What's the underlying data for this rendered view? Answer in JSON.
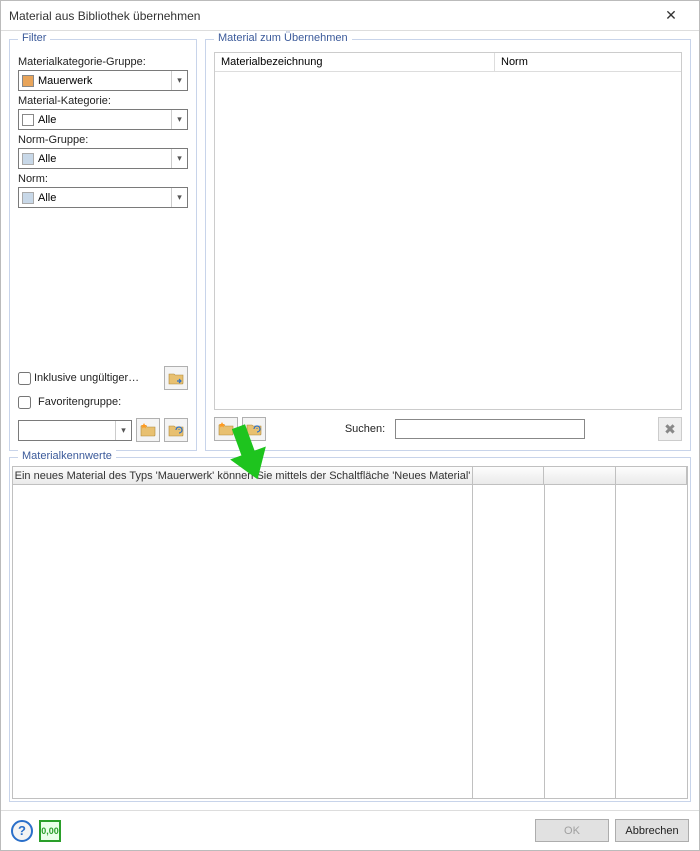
{
  "window": {
    "title": "Material aus Bibliothek übernehmen"
  },
  "filter": {
    "group_title": "Filter",
    "labels": {
      "mk_gruppe": "Materialkategorie-Gruppe:",
      "mk_kat": "Material-Kategorie:",
      "norm_gruppe": "Norm-Gruppe:",
      "norm": "Norm:",
      "inkl_ungueltig": "Inklusive ungültiger…",
      "favoriten": "Favoritengruppe:"
    },
    "values": {
      "mk_gruppe": "Mauerwerk",
      "mk_kat": "Alle",
      "norm_gruppe": "Alle",
      "norm": "Alle",
      "favoriten": ""
    }
  },
  "material_list": {
    "group_title": "Material zum Übernehmen",
    "columns": {
      "materialbezeichnung": "Materialbezeichnung",
      "norm": "Norm"
    },
    "rows": [],
    "search_label": "Suchen:",
    "search_value": ""
  },
  "mk": {
    "group_title": "Materialkennwerte",
    "hint": "Ein neues Material des Typs 'Mauerwerk' können Sie mittels der Schaltfläche 'Neues Material'"
  },
  "footer": {
    "ok": "OK",
    "cancel": "Abbrechen"
  },
  "icons": {
    "folder_new": "folder-new-icon",
    "folder_refresh": "folder-refresh-icon",
    "folder_browse": "folder-browse-icon",
    "delete": "delete-icon",
    "help": "help-icon",
    "format": "format-num-icon"
  }
}
